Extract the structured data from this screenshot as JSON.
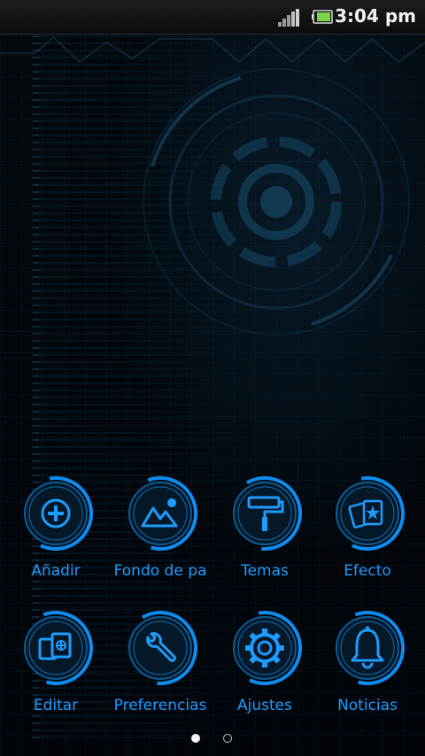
{
  "status_bar": {
    "time": "3:04 pm",
    "icons": [
      "signal-icon",
      "battery-icon"
    ]
  },
  "menu": {
    "items": [
      {
        "label": "Añadir",
        "icon": "plus-icon"
      },
      {
        "label": "Fondo de pa",
        "icon": "wallpaper-icon"
      },
      {
        "label": "Temas",
        "icon": "paint-roller-icon"
      },
      {
        "label": "Efecto",
        "icon": "effect-cards-icon"
      },
      {
        "label": "Editar",
        "icon": "edit-icon"
      },
      {
        "label": "Preferencias",
        "icon": "wrench-icon"
      },
      {
        "label": "Ajustes",
        "icon": "gear-icon"
      },
      {
        "label": "Noticias",
        "icon": "bell-icon"
      }
    ]
  },
  "pager": {
    "pages": 2,
    "current": 1
  },
  "colors": {
    "accent": "#1f9bff",
    "ring": "#0d7ee8",
    "background": "#02060a"
  }
}
